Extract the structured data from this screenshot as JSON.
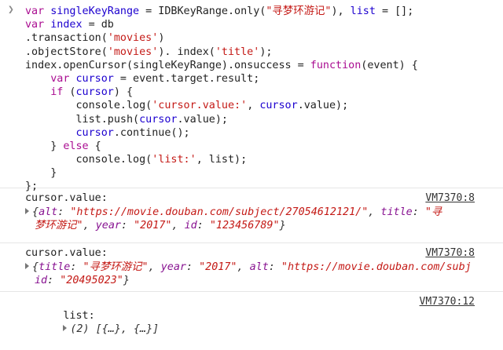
{
  "command": {
    "lines": [
      [
        [
          "kw",
          "var "
        ],
        [
          "var",
          "singleKeyRange"
        ],
        [
          "plain",
          " = IDBKeyRange.only("
        ],
        [
          "str",
          "\"寻梦环游记\""
        ],
        [
          "plain",
          "), "
        ],
        [
          "var",
          "list"
        ],
        [
          "plain",
          " = [];"
        ]
      ],
      [
        [
          "kw",
          "var "
        ],
        [
          "var",
          "index"
        ],
        [
          "plain",
          " = db"
        ]
      ],
      [
        [
          "plain",
          ".transaction("
        ],
        [
          "str",
          "'movies'"
        ],
        [
          "plain",
          ")"
        ]
      ],
      [
        [
          "plain",
          ".objectStore("
        ],
        [
          "str",
          "'movies'"
        ],
        [
          "plain",
          "). index("
        ],
        [
          "str",
          "'title'"
        ],
        [
          "plain",
          ");"
        ]
      ],
      [
        [
          "plain",
          "index.openCursor(singleKeyRange).onsuccess = "
        ],
        [
          "kw",
          "function"
        ],
        [
          "plain",
          "(event) {"
        ]
      ],
      [
        [
          "plain",
          "    "
        ],
        [
          "kw",
          "var "
        ],
        [
          "var",
          "cursor"
        ],
        [
          "plain",
          " = event.target.result;"
        ]
      ],
      [
        [
          "plain",
          "    "
        ],
        [
          "kw",
          "if"
        ],
        [
          "plain",
          " ("
        ],
        [
          "var",
          "cursor"
        ],
        [
          "plain",
          ") {"
        ]
      ],
      [
        [
          "plain",
          "        console.log("
        ],
        [
          "str",
          "'cursor.value:'"
        ],
        [
          "plain",
          ", "
        ],
        [
          "var",
          "cursor"
        ],
        [
          "plain",
          ".value);"
        ]
      ],
      [
        [
          "plain",
          "        list.push("
        ],
        [
          "var",
          "cursor"
        ],
        [
          "plain",
          ".value);"
        ]
      ],
      [
        [
          "plain",
          "        "
        ],
        [
          "var",
          "cursor"
        ],
        [
          "plain",
          ".continue();"
        ]
      ],
      [
        [
          "plain",
          "    } "
        ],
        [
          "kw",
          "else"
        ],
        [
          "plain",
          " {"
        ]
      ],
      [
        [
          "plain",
          "        console.log("
        ],
        [
          "str",
          "'list:'"
        ],
        [
          "plain",
          ", list);"
        ]
      ],
      [
        [
          "plain",
          "    }"
        ]
      ],
      [
        [
          "plain",
          "};"
        ]
      ]
    ]
  },
  "logs": [
    {
      "label": "cursor.value:",
      "source": "VM7370:8",
      "obj_lines": [
        [
          [
            "gray",
            "{"
          ],
          [
            "key",
            "alt"
          ],
          [
            "gray",
            ": "
          ],
          [
            "sval",
            "\"https://movie.douban.com/subject/27054612121/\""
          ],
          [
            "gray",
            ", "
          ],
          [
            "key",
            "title"
          ],
          [
            "gray",
            ": "
          ],
          [
            "sval",
            "\"寻"
          ]
        ],
        [
          [
            "sval",
            "梦环游记\""
          ],
          [
            "gray",
            ", "
          ],
          [
            "key",
            "year"
          ],
          [
            "gray",
            ": "
          ],
          [
            "sval",
            "\"2017\""
          ],
          [
            "gray",
            ", "
          ],
          [
            "key",
            "id"
          ],
          [
            "gray",
            ": "
          ],
          [
            "sval",
            "\"123456789\""
          ],
          [
            "gray",
            "}"
          ]
        ]
      ]
    },
    {
      "label": "cursor.value:",
      "source": "VM7370:8",
      "obj_lines": [
        [
          [
            "gray",
            "{"
          ],
          [
            "key",
            "title"
          ],
          [
            "gray",
            ": "
          ],
          [
            "sval",
            "\"寻梦环游记\""
          ],
          [
            "gray",
            ", "
          ],
          [
            "key",
            "year"
          ],
          [
            "gray",
            ": "
          ],
          [
            "sval",
            "\"2017\""
          ],
          [
            "gray",
            ", "
          ],
          [
            "key",
            "alt"
          ],
          [
            "gray",
            ": "
          ],
          [
            "sval",
            "\"https://movie.douban.com/subj"
          ]
        ],
        [
          [
            "key",
            "id"
          ],
          [
            "gray",
            ": "
          ],
          [
            "sval",
            "\"20495023\""
          ],
          [
            "gray",
            "}"
          ]
        ]
      ]
    },
    {
      "label": "list:",
      "summary": "(2) [{…}, {…}]",
      "source": "VM7370:12"
    }
  ]
}
